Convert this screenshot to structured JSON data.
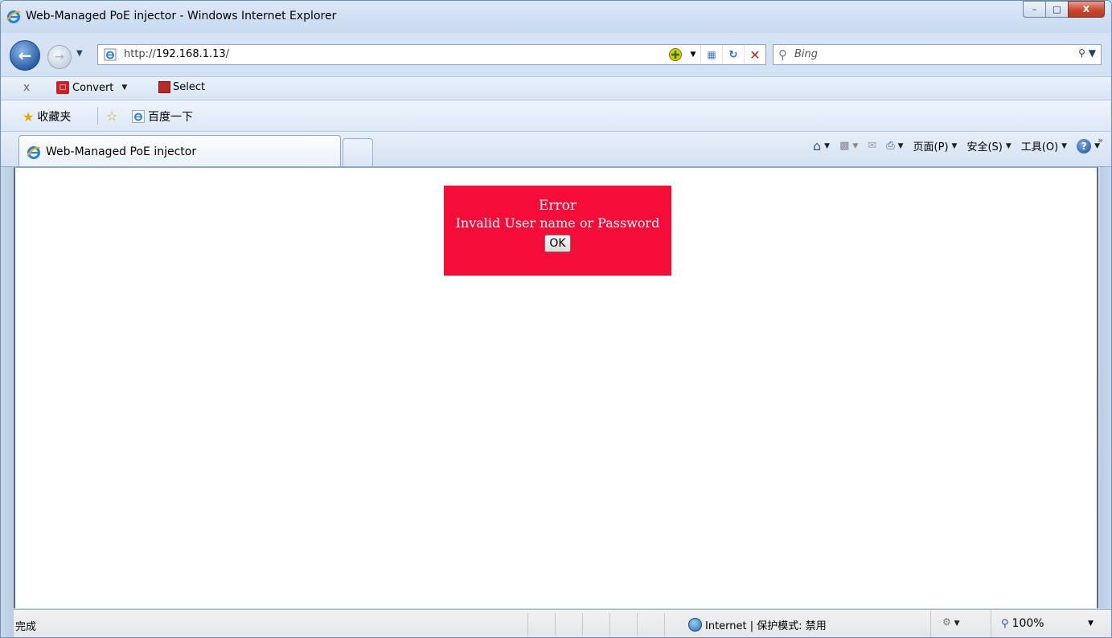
{
  "window": {
    "title": "Web-Managed PoE injector - Windows Internet Explorer",
    "minimize_label": "–",
    "maximize_label": "□",
    "close_label": "X"
  },
  "toolbar": {
    "back_icon": "back-arrow-icon",
    "forward_icon": "forward-arrow-icon",
    "url_prefix": "http://",
    "url_host": "192.168.1.13",
    "url_suffix": "/",
    "search_placeholder": "Bing"
  },
  "command_bar": {
    "close_label": "x",
    "convert_label": "Convert",
    "select_label": "Select"
  },
  "favorites": {
    "favorites_label": "收藏夹",
    "baidu_label": "百度一下"
  },
  "tabs": [
    {
      "label": "Web-Managed PoE injector",
      "active": true
    }
  ],
  "tab_tools": {
    "page_label": "页面(P)",
    "safety_label": "安全(S)",
    "tools_label": "工具(O)",
    "more_label": "»"
  },
  "content": {
    "error_title": "Error",
    "error_message": "Invalid User name or Password",
    "ok_label": "OK",
    "error_color": "#f50d3a"
  },
  "statusbar": {
    "status_text": "完成",
    "zone_text": "Internet | 保护模式: 禁用",
    "zoom_text": "100%"
  }
}
